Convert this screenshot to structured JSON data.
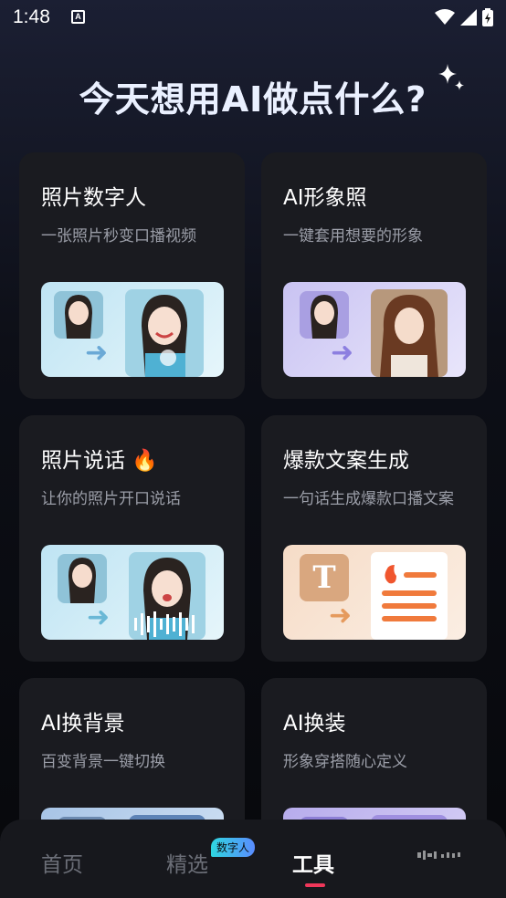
{
  "status_bar": {
    "time": "1:48",
    "notification_letter": "A"
  },
  "headline": "今天想用AI做点什么?",
  "cards": [
    {
      "title": "照片数字人",
      "desc": "一张照片秒变口播视频"
    },
    {
      "title": "AI形象照",
      "desc": "一键套用想要的形象"
    },
    {
      "title": "照片说话",
      "emoji": "🔥",
      "desc": "让你的照片开口说话"
    },
    {
      "title": "爆款文案生成",
      "desc": "一句话生成爆款口播文案",
      "t_letter": "T"
    },
    {
      "title": "AI换背景",
      "desc": "百变背景一键切换"
    },
    {
      "title": "AI换装",
      "desc": "形象穿搭随心定义"
    }
  ],
  "bottom_nav": {
    "items": [
      {
        "label": "首页"
      },
      {
        "label": "精选"
      },
      {
        "label": "工具"
      }
    ],
    "badge": "数字人",
    "active_index": 2
  },
  "colors": {
    "card_bg": "#1a1b20",
    "active_underline": "#f0375a",
    "desc_text": "#9b9ea8"
  }
}
